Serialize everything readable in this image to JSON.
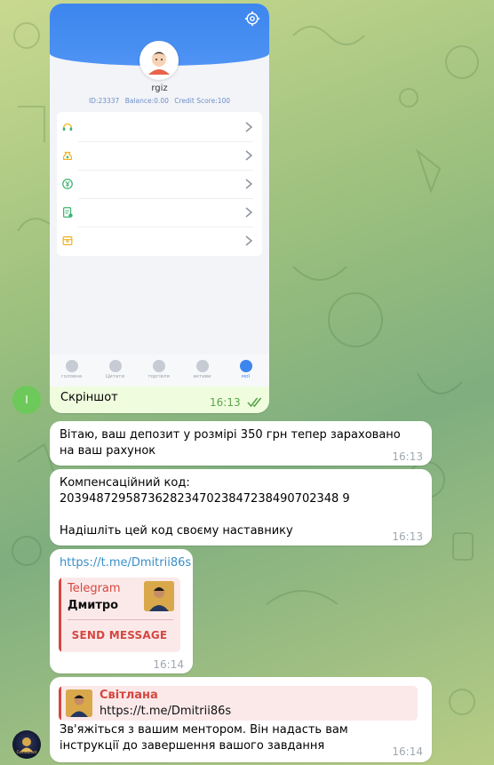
{
  "screenshot": {
    "profile": {
      "username": "rgiz",
      "id_text": "ID:23337",
      "balance_text": "Balance:0.00",
      "credit_text": "Credit Score:100"
    },
    "menu_icons": [
      "headset-icon",
      "moneybag-icon",
      "yuan-coin-icon",
      "document-icon",
      "box-icon"
    ],
    "tabs": [
      {
        "label": "головна",
        "icon": "home-icon"
      },
      {
        "label": "Цитати",
        "icon": "quotes-icon"
      },
      {
        "label": "торгівля",
        "icon": "trade-icon"
      },
      {
        "label": "активи",
        "icon": "wallet-icon"
      },
      {
        "label": "мої",
        "icon": "user-icon",
        "active": true
      }
    ],
    "caption": "Скріншот",
    "time": "16:13"
  },
  "sender_initial": "I",
  "messages": [
    {
      "text": "Вітаю, ваш депозит у розмірі 350 грн тепер зараховано на ваш рахунок",
      "time": "16:13"
    },
    {
      "line1": "Компенсаційний код:",
      "code": "20394872958736282347023847238490702348 9",
      "line3": "Надішліть цей код своєму наставнику",
      "time": "16:13"
    },
    {
      "link": "https://t.me/Dmitrii86s",
      "preview": {
        "site": "Telegram",
        "title": "Дмитро",
        "button": "SEND MESSAGE"
      },
      "time": "16:14"
    },
    {
      "reply": {
        "name": "Світлана",
        "text": "https://t.me/Dmitrii86s"
      },
      "text": "Зв'яжіться з вашим ментором. Він надасть вам інструкції до завершення вашого завдання",
      "time": "16:14"
    }
  ],
  "bot_avatar_label": "CoinMarket",
  "colors": {
    "accent_blue": "#3d86ee",
    "telegram_red": "#d5473f",
    "outgoing_bg": "#effdde",
    "link": "#3a8fc8"
  }
}
